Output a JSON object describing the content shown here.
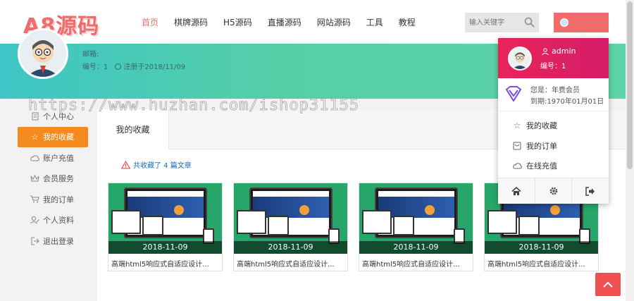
{
  "header": {
    "logo": "A8源码",
    "nav": [
      "首页",
      "棋牌源码",
      "H5源码",
      "直播源码",
      "网站源码",
      "工具",
      "教程"
    ],
    "search_placeholder": "输入关键字"
  },
  "banner": {
    "email_label": "邮箱:",
    "id_text": "编号：1",
    "registered": "注册于2018/11/09"
  },
  "sidebar": {
    "items": [
      {
        "label": "个人中心",
        "icon": "building-icon"
      },
      {
        "label": "我的收藏",
        "icon": "star-icon"
      },
      {
        "label": "账户充值",
        "icon": "cloud-icon"
      },
      {
        "label": "会员服务",
        "icon": "crown-icon"
      },
      {
        "label": "我的订单",
        "icon": "cart-icon"
      },
      {
        "label": "个人资料",
        "icon": "user-edit-icon"
      },
      {
        "label": "退出登录",
        "icon": "logout-icon"
      }
    ]
  },
  "main": {
    "tab": "我的收藏",
    "notice": "共收藏了 4 篇文章",
    "cards": [
      {
        "date": "2018-11-09",
        "title": "高端html5响应式自适应设计..."
      },
      {
        "date": "2018-11-09",
        "title": "高端html5响应式自适应设计..."
      },
      {
        "date": "2018-11-09",
        "title": "高端html5响应式自适应设计..."
      },
      {
        "date": "2018-11-09",
        "title": "高端html5响应式自适应设计..."
      }
    ]
  },
  "dropdown": {
    "username": "admin",
    "id_text": "编号：1",
    "member_line": "您是：年费会员",
    "expiry_line": "到期:1970年01月01日",
    "menu": [
      "我的收藏",
      "我的订单",
      "在线充值"
    ]
  },
  "watermark": "https://www.huzhan.com/ishop31155",
  "colors": {
    "brand": "#f06b6b",
    "active_side": "#f58b1f",
    "dropdown_head": "#e8245a",
    "link": "#1e6fb8"
  }
}
